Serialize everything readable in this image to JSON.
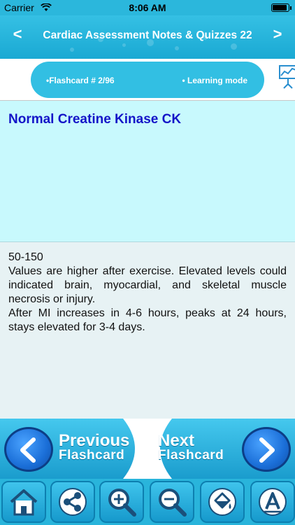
{
  "status": {
    "carrier": "Carrier",
    "time": "8:06 AM"
  },
  "header": {
    "title": "Cardiac Assessment Notes & Quizzes 22",
    "prev_glyph": "<",
    "next_glyph": ">"
  },
  "info": {
    "flashcard": "•Flashcard # 2/96",
    "mode": "• Learning mode"
  },
  "card": {
    "question": "Normal Creatine Kinase CK",
    "answer_lines": [
      "50-150",
      "Values are higher after exercise. Elevated levels could indicated brain, myocardial, and skeletal muscle necrosis or injury.",
      "After MI increases in 4-6 hours, peaks at 24 hours, stays elevated for 3-4 days."
    ]
  },
  "nav": {
    "previous_line1": "Previous",
    "previous_line2": "Flashcard",
    "next_line1": "Next",
    "next_line2": "Flashcard"
  },
  "toolbar": {
    "items": [
      "home-icon",
      "share-icon",
      "zoom-in-icon",
      "zoom-out-icon",
      "paint-bucket-icon",
      "font-icon"
    ]
  },
  "colors": {
    "accent": "#2bb7dc",
    "question_bg": "#c8f9fd",
    "question_text": "#1414c8",
    "answer_bg": "#e7f2f4"
  }
}
